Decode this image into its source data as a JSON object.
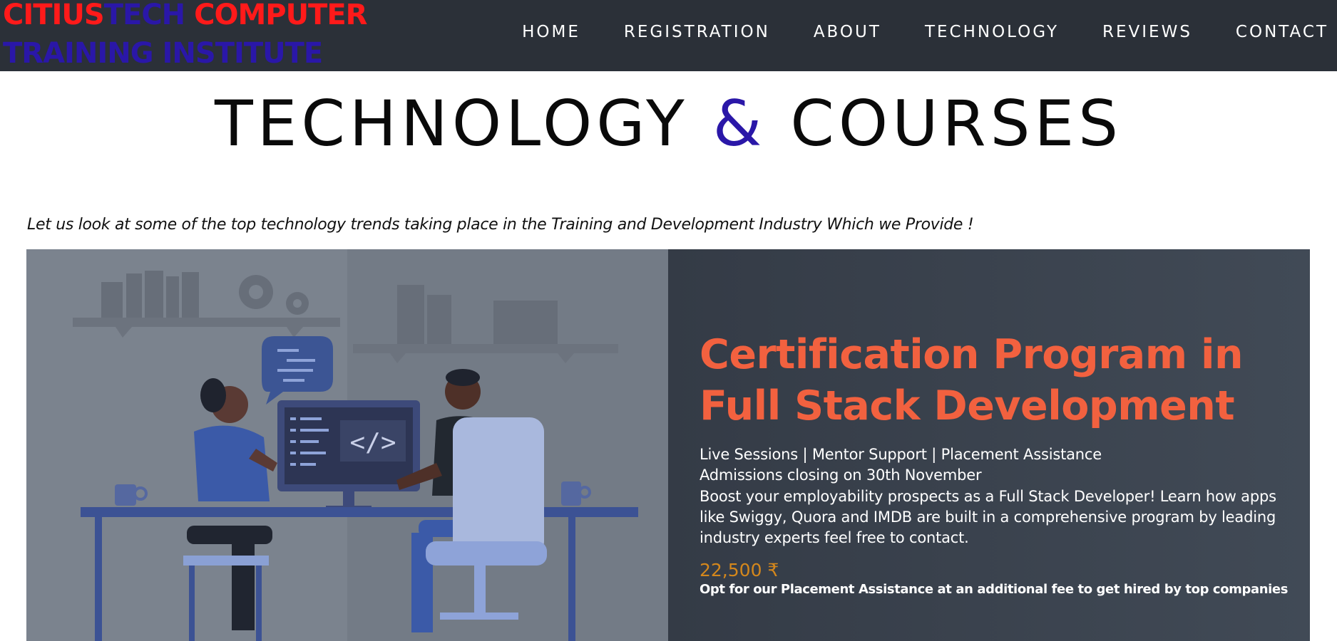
{
  "header": {
    "logo": {
      "part1": "CITIUS",
      "part2": "TECH",
      "part3": " COMPUTER",
      "line2": "TRAINING INSTITUTE"
    },
    "nav": [
      "HOME",
      "REGISTRATION",
      "ABOUT",
      "TECHNOLOGY",
      "REVIEWS",
      "CONTACT"
    ]
  },
  "main": {
    "heading_pre": "TECHNOLOGY ",
    "heading_amp": "&",
    "heading_post": " COURSES",
    "intro": "Let us look at some of the top technology trends taking place in the Training and Development Industry Which we Provide !",
    "course": {
      "title": "Certification Program in Full Stack Development",
      "features": "Live Sessions | Mentor Support | Placement Assistance",
      "admissions": "Admissions closing on 30th November",
      "description": "Boost your employability prospects as a Full Stack Developer! Learn how apps like Swiggy, Quora and IMDB are built in a comprehensive program by leading industry experts feel free to contact.",
      "price": "22,500 ₹",
      "placement_note": "Opt for our Placement Assistance at an additional fee to get hired by top companies",
      "illustration_code_symbol": "</>"
    }
  },
  "colors": {
    "nav_bg": "#2b3038",
    "logo_red": "#ff1a1a",
    "logo_blue": "#2a17a8",
    "title_orange": "#f2613f",
    "price_gold": "#d4871c"
  }
}
